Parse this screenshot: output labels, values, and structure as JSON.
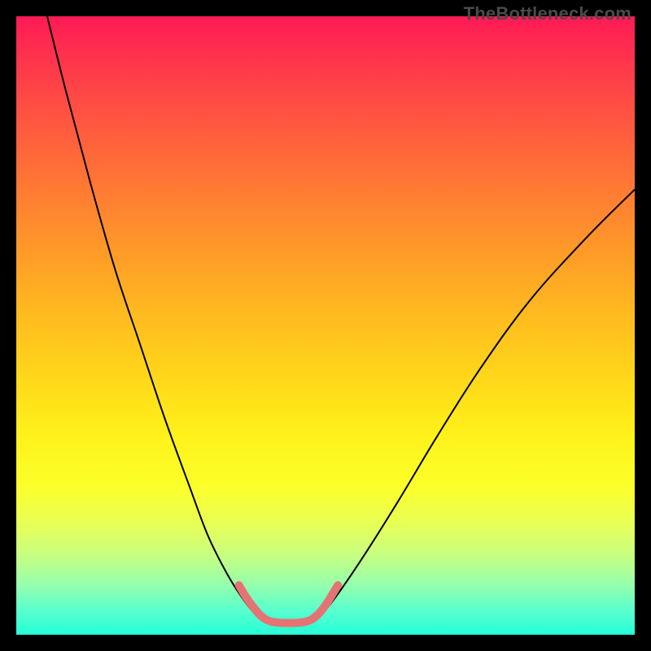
{
  "watermark": {
    "text": "TheBottleneck.com"
  },
  "chart_data": {
    "type": "line",
    "title": "",
    "xlabel": "",
    "ylabel": "",
    "xlim": [
      0,
      100
    ],
    "ylim": [
      0,
      100
    ],
    "grid": false,
    "series": [
      {
        "name": "curve-left",
        "color": "#000000",
        "width": 2,
        "x": [
          5,
          8,
          12,
          16,
          20,
          24,
          28,
          31,
          34,
          36.5,
          38.5,
          40
        ],
        "y": [
          100,
          88,
          73,
          59,
          47,
          35,
          24,
          16,
          10,
          6,
          3.5,
          2.5
        ]
      },
      {
        "name": "curve-right",
        "color": "#000000",
        "width": 2,
        "x": [
          48,
          50,
          53,
          57,
          62,
          68,
          75,
          83,
          92,
          100
        ],
        "y": [
          2.5,
          4,
          8,
          14,
          22,
          32,
          43,
          54,
          64,
          72
        ]
      },
      {
        "name": "pink-overlay-left",
        "color": "#e57373",
        "width": 10,
        "x": [
          36,
          37.2,
          38.3,
          39.3,
          40.3,
          41.3
        ],
        "y": [
          8,
          6,
          4.5,
          3.3,
          2.5,
          2.1
        ]
      },
      {
        "name": "pink-overlay-bottom",
        "color": "#e57373",
        "width": 10,
        "x": [
          41.3,
          42.4,
          43.5,
          44.6,
          45.7,
          46.8
        ],
        "y": [
          2.1,
          1.95,
          1.9,
          1.9,
          1.95,
          2.1
        ]
      },
      {
        "name": "pink-overlay-right",
        "color": "#e57373",
        "width": 10,
        "x": [
          46.8,
          47.8,
          48.8,
          49.8,
          50.8,
          52
        ],
        "y": [
          2.1,
          2.5,
          3.3,
          4.5,
          6,
          8
        ]
      }
    ],
    "dip_center_x": 44,
    "dip_min_y": 1.9
  }
}
